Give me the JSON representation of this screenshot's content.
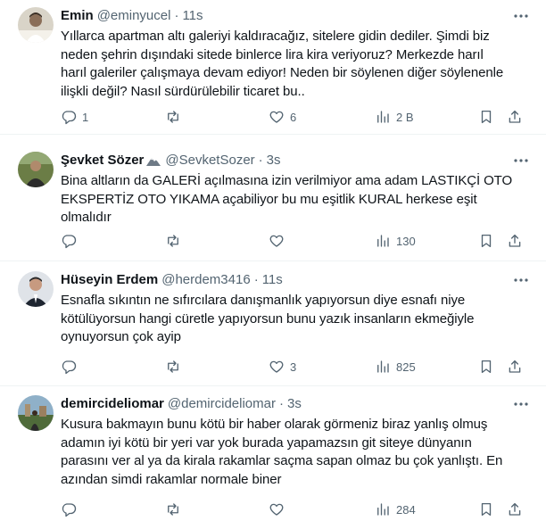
{
  "posts": [
    {
      "name": "Emin",
      "handle": "@eminyucel",
      "time": "11s",
      "text": "Yıllarca apartman altı galeriyi kaldıracağız, sitelere gidin dediler. Şimdi biz\nneden şehrin dışındaki sitede binlerce lira kira veriyoruz? Merkezde harıl\nharıl galeriler çalışmaya devam ediyor! Neden bir söylenen diğer söylenenle\nilişkli değil? Nasıl sürdürülebilir ticaret bu..",
      "replies": "1",
      "reposts": "",
      "likes": "6",
      "views": "2 B",
      "avatar_bg": "#c8c2b4"
    },
    {
      "name": "Şevket Sözer",
      "handle": "@SevketSozer",
      "time": "3s",
      "text": "Bina altların da GALERİ açılmasına izin verilmiyor ama adam LASTIKÇİ OTO\nEKSPERTİZ OTO YIKAMA açabiliyor bu mu eşitlik KURAL herkese eşit\nolmalıdır",
      "replies": "",
      "reposts": "",
      "likes": "",
      "views": "130",
      "avatar_bg": "#5a6a3a"
    },
    {
      "name": "Hüseyin Erdem",
      "handle": "@herdem3416",
      "time": "11s",
      "text": "Esnafla sıkıntın ne sıfırcılara danışmanlık yapıyorsun diye esnafı niye\nkötülüyorsun hangi cüretle yapıyorsun bunu yazık insanların ekmeğiyle\noynuyorsun çok ayip",
      "replies": "",
      "reposts": "",
      "likes": "3",
      "views": "825",
      "avatar_bg": "#2c3340"
    },
    {
      "name": "demircideliomar",
      "handle": "@demircideliomar",
      "time": "3s",
      "text": "Kusura bakmayın bunu kötü bir haber olarak görmeniz biraz yanlış olmuş\nadamın iyi kötü bir yeri var yok burada yapamazsın git siteye dünyanın\nparasını ver al ya da kirala rakamlar saçma sapan olmaz bu çok yanlıştı. En\nazından simdi rakamlar normale biner",
      "replies": "",
      "reposts": "",
      "likes": "",
      "views": "284",
      "avatar_bg": "#6f8aa0"
    }
  ],
  "colors": {
    "text": "#0f1419",
    "secondary": "#536471",
    "divider": "#eff3f4"
  }
}
